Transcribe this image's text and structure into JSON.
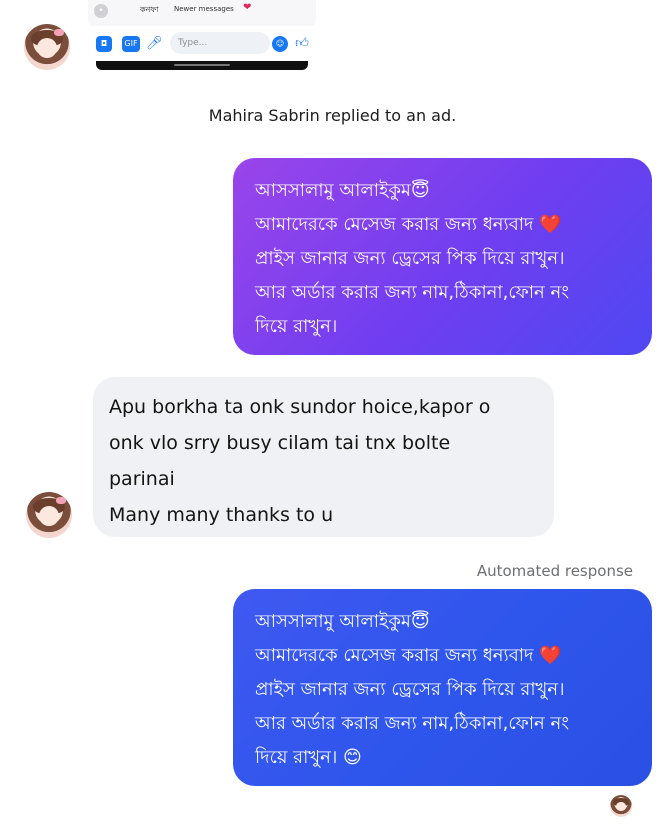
{
  "shared_screenshot": {
    "name_text": "কনফা",
    "newer_messages": "Newer messages",
    "heart": "❤",
    "type_placeholder": "Type...",
    "icons": [
      "camera-icon",
      "gif-icon",
      "mic-icon",
      "emoji-icon",
      "like-icon"
    ]
  },
  "system_note": "Mahira Sabrin replied to an ad.",
  "outgoing_message_1": {
    "lines": [
      "আসসালামু আলাইকুম😇",
      "আমাদেরকে মেসেজ করার জন্য ধন্যবাদ ❤️",
      "প্রাইস জানার জন্য ড্রেসের পিক দিয়ে রাখুন।",
      "আর অর্ডার করার জন্য নাম,ঠিকানা,ফোন নং",
      "দিয়ে রাখুন।"
    ]
  },
  "incoming_message": {
    "lines": [
      "Apu borkha ta onk sundor hoice,kapor o",
      "onk vlo srry busy cilam tai tnx bolte",
      "parinai",
      "Many many thanks to u"
    ]
  },
  "automated_label": "Automated response",
  "outgoing_message_2": {
    "lines": [
      "আসসালামু আলাইকুম😇",
      "আমাদেরকে মেসেজ করার জন্য ধন্যবাদ ❤️",
      "প্রাইস জানার জন্য ড্রেসের পিক দিয়ে রাখুন।",
      "আর অর্ডার করার জন্য নাম,ঠিকানা,ফোন নং",
      "দিয়ে রাখুন। 😊"
    ]
  },
  "colors": {
    "outgoing_1_gradient_start": "#9a45ea",
    "outgoing_1_gradient_end": "#4f48f2",
    "outgoing_2": "#2f56ec",
    "incoming_bg": "#f0f1f4"
  }
}
